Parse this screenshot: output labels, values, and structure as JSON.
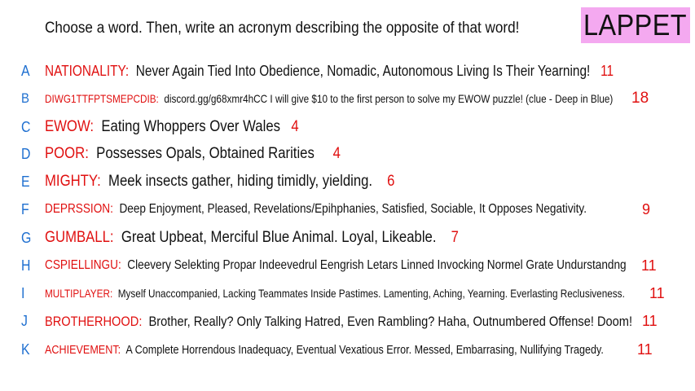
{
  "prompt": "Choose a word. Then, write an acronym describing the opposite of that word!",
  "badge": "LAPPET",
  "colors": {
    "letter": "#1e6fd0",
    "word": "#e01010",
    "badge_bg": "#f4a9f0",
    "text": "#111111"
  },
  "entries": [
    {
      "letter": "A",
      "word": "NATIONALITY",
      "sep": ":",
      "phrase": "Never Again Tied Into Obedience, Nomadic, Autonomous Living Is Their Yearning!",
      "score": "11"
    },
    {
      "letter": "B",
      "word": "DIWG1TTFPTSMEPCDIB",
      "sep": ":",
      "phrase": "discord.gg/g68xmr4hCC  I will give $10 to the first person to solve my EWOW puzzle! (clue - Deep in Blue)",
      "score": "18"
    },
    {
      "letter": "C",
      "word": "EWOW",
      "sep": ":",
      "phrase": "Eating Whoppers Over Wales",
      "score": "4"
    },
    {
      "letter": "D",
      "word": "POOR",
      "sep": ":",
      "phrase": "Possesses Opals, Obtained Rarities",
      "score": "4"
    },
    {
      "letter": "E",
      "word": "MIGHTY",
      "sep": ":",
      "phrase": "Meek insects gather, hiding timidly, yielding.",
      "score": "6"
    },
    {
      "letter": "F",
      "word": "DEPRSSION",
      "sep": ":",
      "phrase": "Deep Enjoyment, Pleased, Revelations/Epihphanies, Satisfied, Sociable, It Opposes Negativity.",
      "score": "9"
    },
    {
      "letter": "G",
      "word": "GUMBALL",
      "sep": ":",
      "phrase": "Great Upbeat, Merciful Blue Animal.  Loyal, Likeable.",
      "score": "7"
    },
    {
      "letter": "H",
      "word": "CSPIELLINGU",
      "sep": ":",
      "phrase": "Cleevery Selekting Propar Indeevedrul Eengrish Letars Linned Invocking Normel Grate Undurstandng",
      "score": "11"
    },
    {
      "letter": "I",
      "word": "MULTIPLAYER",
      "sep": ":",
      "phrase": "Myself Unaccompanied, Lacking Teammates Inside Pastimes. Lamenting, Aching, Yearning. Everlasting Reclusiveness.",
      "score": "11"
    },
    {
      "letter": "J",
      "word": "BROTHERHOOD",
      "sep": ":",
      "phrase": "Brother, Really? Only Talking Hatred, Even Rambling? Haha, Outnumbered Offense! Doom!",
      "score": "11"
    },
    {
      "letter": "K",
      "word": "ACHIEVEMENT",
      "sep": ":",
      "phrase": "A Complete Horrendous Inadequacy, Eventual Vexatious Error. Messed, Embarrasing, Nullifying Tragedy.",
      "score": "11"
    }
  ]
}
